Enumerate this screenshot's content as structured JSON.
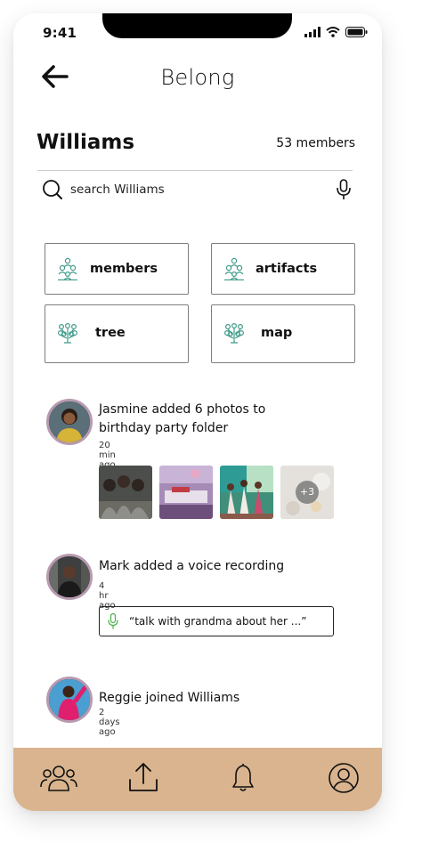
{
  "status_bar": {
    "time": "9:41"
  },
  "header": {
    "title": "Belong"
  },
  "group": {
    "name": "Williams",
    "member_count": "53 members"
  },
  "search": {
    "text": "search Williams"
  },
  "tiles": [
    {
      "label": "members",
      "icon": "members-icon"
    },
    {
      "label": "artifacts",
      "icon": "artifacts-icon"
    },
    {
      "label": "tree",
      "icon": "tree-icon"
    },
    {
      "label": "map",
      "icon": "map-icon"
    }
  ],
  "feed": [
    {
      "text": "Jasmine added 6 photos to birthday party folder",
      "time": "20 min ago",
      "more_photos": "+3"
    },
    {
      "text": "Mark added a voice recording",
      "time": "4 hr ago",
      "quote": "“talk with grandma about her ...”"
    },
    {
      "text": "Reggie joined Williams",
      "time": "2 days ago"
    }
  ],
  "colors": {
    "accent_teal": "#3f9b8a",
    "nav_background": "#d9b48e",
    "avatar_ring": "#b89ab0",
    "mic_green": "#48b04a"
  },
  "bottom_nav": [
    "community-icon",
    "upload-icon",
    "bell-icon",
    "profile-icon"
  ]
}
